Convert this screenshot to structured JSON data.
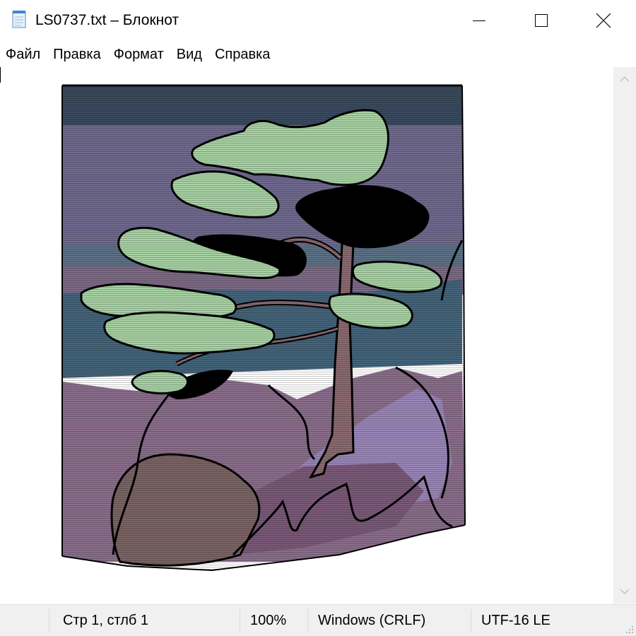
{
  "window": {
    "title": "LS0737.txt – Блокнот",
    "app_icon": "notepad-icon",
    "controls": {
      "minimize": "minimize-icon",
      "maximize": "maximize-icon",
      "close": "close-icon"
    }
  },
  "menu": {
    "items": [
      {
        "label": "Файл",
        "name": "menu-file"
      },
      {
        "label": "Правка",
        "name": "menu-edit"
      },
      {
        "label": "Формат",
        "name": "menu-format"
      },
      {
        "label": "Вид",
        "name": "menu-view"
      },
      {
        "label": "Справка",
        "name": "menu-help"
      }
    ]
  },
  "editor": {
    "content_description_icon": "ascii-art-pine-tree",
    "palette": {
      "sky_top": "#3a4a5e",
      "sky": "#6f6a8e",
      "haze": "#5d7186",
      "water": "#44647a",
      "rock": "#8b6e8c",
      "rock_dark": "#7a5a78",
      "light_rock": "#9a86b8",
      "foliage": "#a8d2a4",
      "foliage_dark": "#000000",
      "trunk": "#8a6a70",
      "boulder": "#7b6464",
      "outline": "#000000"
    }
  },
  "scrollbar": {
    "up": "chevron-up-icon",
    "down": "chevron-down-icon"
  },
  "status": {
    "position": "Стр 1, стлб 1",
    "zoom": "100%",
    "line_endings": "Windows (CRLF)",
    "encoding": "UTF-16 LE",
    "grip": "resize-grip-icon"
  }
}
